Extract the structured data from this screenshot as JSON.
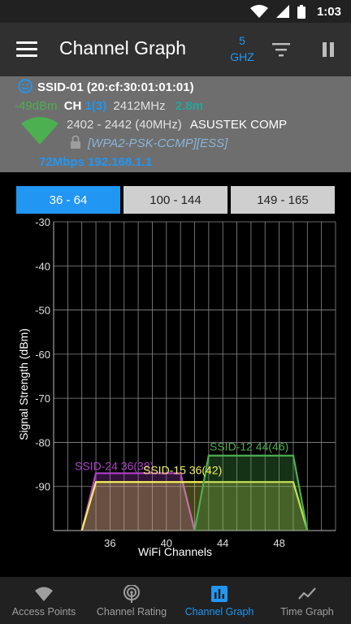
{
  "status_bar": {
    "time": "1:03"
  },
  "app_bar": {
    "title": "Channel Graph",
    "band_value": "5",
    "band_unit": "GHZ"
  },
  "connection": {
    "ssid_line": "SSID-01 (20:cf:30:01:01:01)",
    "signal": "-49dBm",
    "ch_label": "CH",
    "channel": "1(3)",
    "frequency": "2412MHz",
    "distance": "2.8m",
    "range": "2402 - 2442 (40MHz)",
    "vendor": "ASUSTEK COMP",
    "security": "[WPA2-PSK-CCMP][ESS]",
    "link": "72Mbps 192.168.1.1"
  },
  "tabs": [
    {
      "label": "36 - 64",
      "active": true
    },
    {
      "label": "100 - 144",
      "active": false
    },
    {
      "label": "149 - 165",
      "active": false
    }
  ],
  "chart_data": {
    "type": "area",
    "xlabel": "WiFi Channels",
    "ylabel": "Signal Strength (dBm)",
    "xlim": [
      32,
      52
    ],
    "ylim": [
      -100,
      -30
    ],
    "x_ticks": [
      "36",
      "40",
      "44",
      "48"
    ],
    "x_tick_values": [
      36,
      40,
      44,
      48
    ],
    "y_ticks": [
      "-30",
      "-40",
      "-50",
      "-60",
      "-70",
      "-80",
      "-90"
    ],
    "y_tick_values": [
      -30,
      -40,
      -50,
      -60,
      -70,
      -80,
      -90
    ],
    "grid": true,
    "series": [
      {
        "name": "SSID-24 36(38)",
        "color": "#b040c8",
        "x_start": 34,
        "x_end": 42,
        "signal": -87
      },
      {
        "name": "SSID-15 36(42)",
        "color": "#f5f15a",
        "x_start": 34,
        "x_end": 50,
        "signal": -89
      },
      {
        "name": "SSID-12 44(46)",
        "color": "#4caf50",
        "x_start": 42,
        "x_end": 50,
        "signal": -83
      }
    ]
  },
  "bottom_nav": [
    {
      "label": "Access Points",
      "icon": "wifi-icon",
      "active": false
    },
    {
      "label": "Channel Rating",
      "icon": "radar-icon",
      "active": false
    },
    {
      "label": "Channel Graph",
      "icon": "bar-chart-icon",
      "active": true
    },
    {
      "label": "Time Graph",
      "icon": "line-chart-icon",
      "active": false
    }
  ],
  "colors": {
    "accent": "#2196f3",
    "app_bar": "#303030",
    "info_panel": "#6e6e6e",
    "signal_good": "#4caf50"
  }
}
